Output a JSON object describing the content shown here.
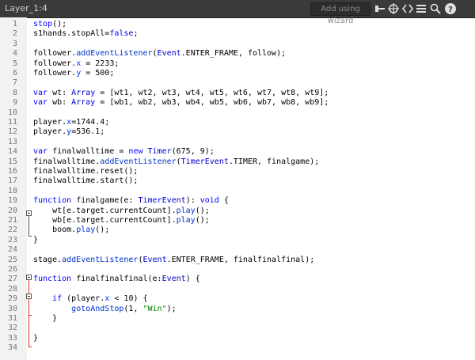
{
  "header": {
    "layer_title": "Layer_1:4",
    "wizard_label": "Add using wizard",
    "icons": [
      "pin-icon",
      "target-icon",
      "code-brackets-icon",
      "list-icon",
      "settings-icon",
      "search-icon",
      "help-icon"
    ]
  },
  "lines": [
    {
      "n": "1",
      "code": [
        [
          "kw",
          "stop"
        ],
        [
          "",
          "();"
        ]
      ]
    },
    {
      "n": "2",
      "code": [
        [
          "",
          "s1hands.stopAll="
        ],
        [
          "kw",
          "false"
        ],
        [
          "",
          ";"
        ]
      ]
    },
    {
      "n": "3",
      "code": []
    },
    {
      "n": "4",
      "code": [
        [
          "",
          "follower."
        ],
        [
          "fn",
          "addEventListener"
        ],
        [
          "",
          "("
        ],
        [
          "ty",
          "Event"
        ],
        [
          "",
          ".ENTER_FRAME, follow);"
        ]
      ]
    },
    {
      "n": "5",
      "code": [
        [
          "",
          "follower."
        ],
        [
          "pr",
          "x"
        ],
        [
          "",
          " = 2233;"
        ]
      ]
    },
    {
      "n": "6",
      "code": [
        [
          "",
          "follower."
        ],
        [
          "pr",
          "y"
        ],
        [
          "",
          " = 500;"
        ]
      ]
    },
    {
      "n": "7",
      "code": []
    },
    {
      "n": "8",
      "code": [
        [
          "kw",
          "var"
        ],
        [
          "",
          " wt: "
        ],
        [
          "ty",
          "Array"
        ],
        [
          "",
          " = [wt1, wt2, wt3, wt4, wt5, wt6, wt7, wt8, wt9];"
        ]
      ]
    },
    {
      "n": "9",
      "code": [
        [
          "kw",
          "var"
        ],
        [
          "",
          " wb: "
        ],
        [
          "ty",
          "Array"
        ],
        [
          "",
          " = [wb1, wb2, wb3, wb4, wb5, wb6, wb7, wb8, wb9];"
        ]
      ]
    },
    {
      "n": "10",
      "code": []
    },
    {
      "n": "11",
      "code": [
        [
          "",
          "player."
        ],
        [
          "pr",
          "x"
        ],
        [
          "",
          "=1744.4;"
        ]
      ]
    },
    {
      "n": "12",
      "code": [
        [
          "",
          "player."
        ],
        [
          "pr",
          "y"
        ],
        [
          "",
          "=536.1;"
        ]
      ]
    },
    {
      "n": "13",
      "code": []
    },
    {
      "n": "14",
      "code": [
        [
          "kw",
          "var"
        ],
        [
          "",
          " finalwalltime = "
        ],
        [
          "kw",
          "new"
        ],
        [
          "",
          " "
        ],
        [
          "ty",
          "Timer"
        ],
        [
          "",
          "(675, 9);"
        ]
      ]
    },
    {
      "n": "15",
      "code": [
        [
          "",
          "finalwalltime."
        ],
        [
          "fn",
          "addEventListener"
        ],
        [
          "",
          "("
        ],
        [
          "ty",
          "TimerEvent"
        ],
        [
          "",
          ".TIMER, finalgame);"
        ]
      ]
    },
    {
      "n": "16",
      "code": [
        [
          "",
          "finalwalltime.reset();"
        ]
      ]
    },
    {
      "n": "17",
      "code": [
        [
          "",
          "finalwalltime.start();"
        ]
      ]
    },
    {
      "n": "18",
      "code": []
    },
    {
      "n": "19",
      "code": [
        [
          "kw",
          "function"
        ],
        [
          "",
          " finalgame(e: "
        ],
        [
          "ty",
          "TimerEvent"
        ],
        [
          "",
          "): "
        ],
        [
          "kw",
          "void"
        ],
        [
          "",
          " {"
        ]
      ]
    },
    {
      "n": "20",
      "code": [
        [
          "",
          "    wt[e.target.currentCount]."
        ],
        [
          "fn",
          "play"
        ],
        [
          "",
          "();"
        ]
      ]
    },
    {
      "n": "21",
      "code": [
        [
          "",
          "    wb[e.target.currentCount]."
        ],
        [
          "fn",
          "play"
        ],
        [
          "",
          "();"
        ]
      ]
    },
    {
      "n": "22",
      "code": [
        [
          "",
          "    boom."
        ],
        [
          "fn",
          "play"
        ],
        [
          "",
          "();"
        ]
      ]
    },
    {
      "n": "23",
      "code": [
        [
          "",
          "}"
        ]
      ]
    },
    {
      "n": "24",
      "code": []
    },
    {
      "n": "25",
      "code": [
        [
          "",
          "stage."
        ],
        [
          "fn",
          "addEventListener"
        ],
        [
          "",
          "("
        ],
        [
          "ty",
          "Event"
        ],
        [
          "",
          ".ENTER_FRAME, finalfinalfinal);"
        ]
      ]
    },
    {
      "n": "26",
      "code": []
    },
    {
      "n": "27",
      "code": [
        [
          "kw",
          "function"
        ],
        [
          "",
          " finalfinalfinal(e:"
        ],
        [
          "ty",
          "Event"
        ],
        [
          "",
          ") {"
        ]
      ]
    },
    {
      "n": "28",
      "code": []
    },
    {
      "n": "29",
      "code": [
        [
          "",
          "    "
        ],
        [
          "kw",
          "if"
        ],
        [
          "",
          " (player."
        ],
        [
          "pr",
          "x"
        ],
        [
          "",
          " < 10) {"
        ]
      ]
    },
    {
      "n": "30",
      "code": [
        [
          "",
          "        "
        ],
        [
          "fn",
          "gotoAndStop"
        ],
        [
          "",
          "(1, "
        ],
        [
          "st",
          "\"Win\""
        ],
        [
          "",
          ");"
        ]
      ]
    },
    {
      "n": "31",
      "code": [
        [
          "",
          "    }"
        ]
      ]
    },
    {
      "n": "32",
      "code": []
    },
    {
      "n": "33",
      "code": [
        [
          "",
          "}"
        ]
      ]
    },
    {
      "n": "34",
      "code": []
    }
  ]
}
